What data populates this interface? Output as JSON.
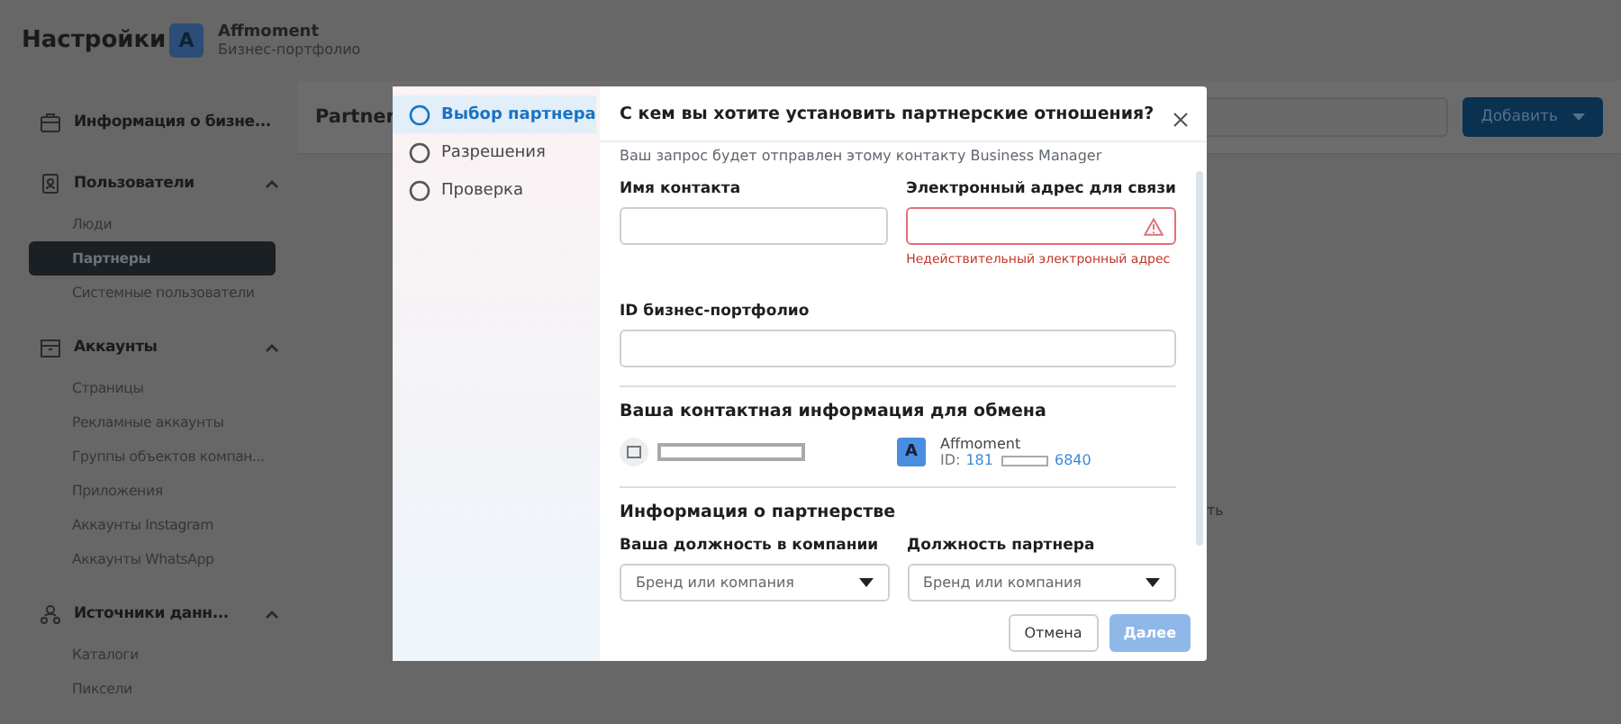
{
  "header": {
    "title": "Настройки",
    "account": {
      "initial": "A",
      "name": "Affmoment",
      "subtitle": "Бизнес-портфолио"
    }
  },
  "sidebar": {
    "sections": [
      {
        "kind": "link",
        "label": "Информация о бизне..."
      },
      {
        "kind": "group",
        "label": "Пользователи",
        "expanded": true,
        "items": [
          {
            "label": "Люди",
            "selected": false
          },
          {
            "label": "Партнеры",
            "selected": true
          },
          {
            "label": "Системные пользователи",
            "selected": false
          }
        ]
      },
      {
        "kind": "group",
        "label": "Аккаунты",
        "expanded": true,
        "items": [
          {
            "label": "Страницы",
            "selected": false
          },
          {
            "label": "Рекламные аккаунты",
            "selected": false
          },
          {
            "label": "Группы объектов компан...",
            "selected": false
          },
          {
            "label": "Приложения",
            "selected": false
          },
          {
            "label": "Аккаунты Instagram",
            "selected": false
          },
          {
            "label": "Аккаунты WhatsApp",
            "selected": false
          }
        ]
      },
      {
        "kind": "group",
        "label": "Источники данн...",
        "expanded": true,
        "items": [
          {
            "label": "Каталоги",
            "selected": false
          },
          {
            "label": "Пиксели",
            "selected": false
          }
        ]
      }
    ]
  },
  "content": {
    "title": "Partner",
    "add_button": "Добавить",
    "hidden_text": "ть"
  },
  "modal": {
    "steps": [
      {
        "label": "Выбор партнера",
        "selected": true
      },
      {
        "label": "Разрешения",
        "selected": false
      },
      {
        "label": "Проверка",
        "selected": false
      }
    ],
    "title": "С кем вы хотите установить партнерские отношения?",
    "subtitle": "Ваш запрос будет отправлен этому контакту Business Manager",
    "contact_name": {
      "label": "Имя контакта"
    },
    "email": {
      "label": "Электронный адрес для связи",
      "invalid": true,
      "error": "Недействительный электронный адрес"
    },
    "business_id": {
      "label": "ID бизнес-портфолио"
    },
    "share": {
      "title": "Ваша контактная информация для обмена",
      "account": {
        "initial": "A",
        "name": "Affmoment",
        "id_label": "ID:",
        "id_start": "181",
        "id_end": "6840"
      }
    },
    "partnership": {
      "title": "Информация о партнерстве",
      "selects": [
        {
          "label": "Ваша должность в компании",
          "value": "Бренд или компания"
        },
        {
          "label": "Должность партнера",
          "value": "Бренд или компания"
        }
      ]
    },
    "buttons": {
      "cancel": "Отмена",
      "next": "Далее",
      "next_disabled": true
    }
  }
}
